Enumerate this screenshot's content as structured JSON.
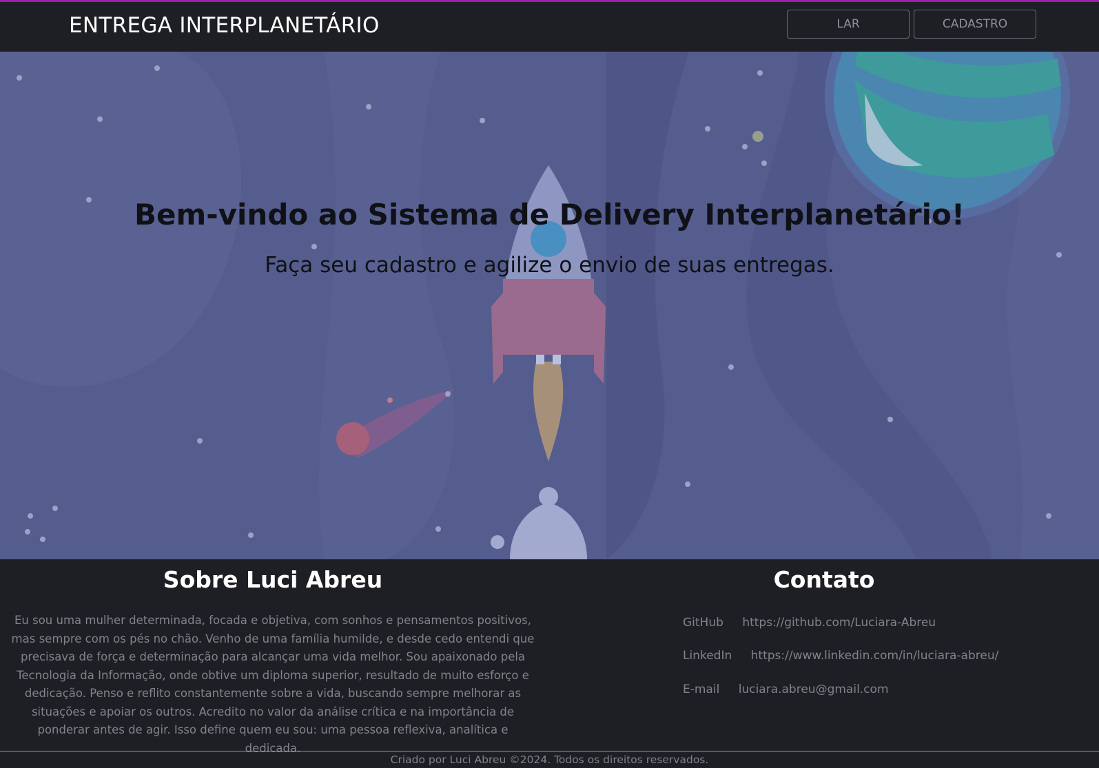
{
  "header": {
    "brand": "ENTREGA INTERPLANETÁRIO",
    "nav": [
      {
        "label": "LAR"
      },
      {
        "label": "CADASTRO"
      }
    ]
  },
  "hero": {
    "title": "Bem-vindo ao Sistema de Delivery Interplanetário!",
    "subtitle": "Faça seu cadastro e agilize o envio de suas entregas."
  },
  "footer": {
    "about": {
      "title": "Sobre Luci Abreu",
      "text": "Eu sou uma mulher determinada, focada e objetiva, com sonhos e pensamentos positivos, mas sempre com os pés no chão. Venho de uma família humilde, e desde cedo entendi que precisava de força e determinação para alcançar uma vida melhor. Sou apaixonado pela Tecnologia da Informação, onde obtive um diploma superior, resultado de muito esforço e dedicação. Penso e reflito constantemente sobre a vida, buscando sempre melhorar as situações e apoiar os outros. Acredito no valor da análise crítica e na importância de ponderar antes de agir. Isso define quem eu sou: uma pessoa reflexiva, analítica e dedicada."
    },
    "contact": {
      "title": "Contato",
      "items": [
        {
          "label": "GitHub",
          "value": "https://github.com/Luciara-Abreu"
        },
        {
          "label": "LinkedIn",
          "value": "https://www.linkedin.com/in/luciara-abreu/"
        },
        {
          "label": "E-mail",
          "value": "luciara.abreu@gmail.com"
        }
      ]
    },
    "copyright": "Criado por Luci Abreu ©2024. Todos os direitos reservados."
  },
  "colors": {
    "accent_line": "#9b1fb0",
    "header_bg": "#1e1f24",
    "hero_bg": "#545d8d"
  },
  "hero_illustration": {
    "elements": [
      "rocket",
      "planet",
      "comet",
      "stars",
      "astronaut"
    ]
  }
}
